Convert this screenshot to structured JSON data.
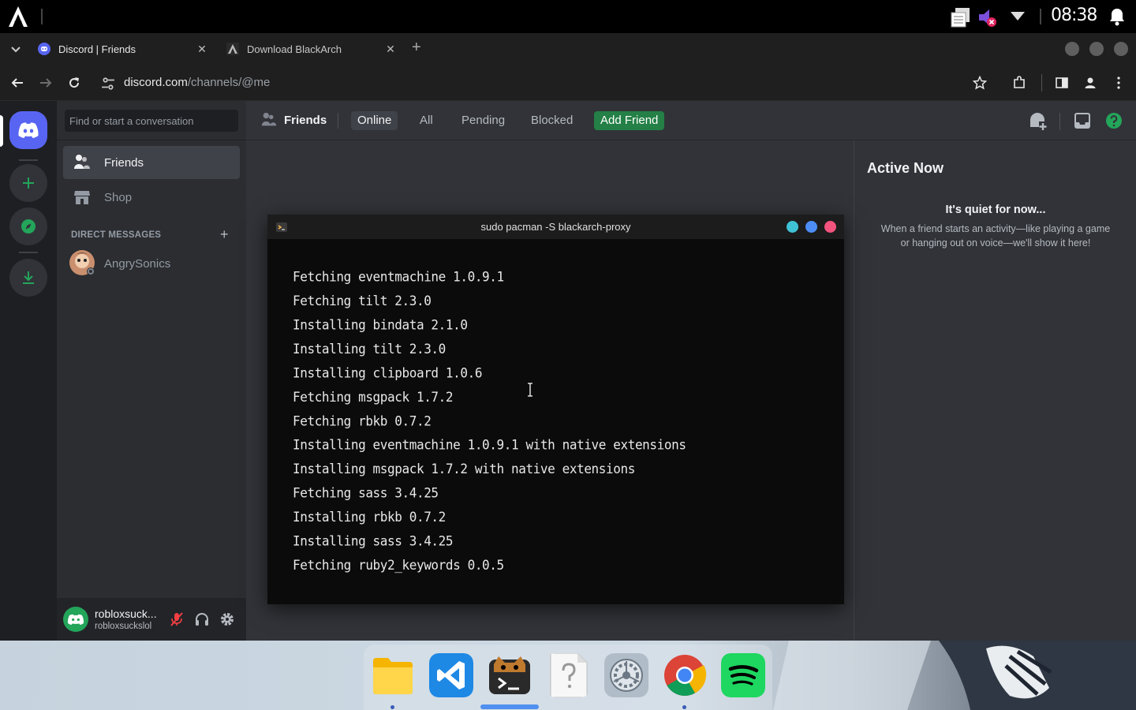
{
  "system": {
    "clock": "08:38"
  },
  "browser": {
    "tabs": [
      {
        "title": "Discord | Friends",
        "close": "✕"
      },
      {
        "title": "Download BlackArch",
        "close": "✕"
      }
    ],
    "new_tab": "+",
    "url_host": "discord.com",
    "url_path": "/channels/@me"
  },
  "discord": {
    "search_placeholder": "Find or start a conversation",
    "nav": {
      "friends": "Friends",
      "shop": "Shop"
    },
    "direct_messages_header": "DIRECT MESSAGES",
    "dm_add": "+",
    "dms": [
      {
        "name": "AngrySonics"
      }
    ],
    "user": {
      "display_name": "robloxsuck...",
      "username": "robloxsuckslol"
    },
    "header": {
      "title": "Friends",
      "tabs": [
        "Online",
        "All",
        "Pending",
        "Blocked"
      ],
      "selected_tab": "Online",
      "add_friend": "Add Friend"
    },
    "active_now": {
      "title": "Active Now",
      "quiet_title": "It's quiet for now...",
      "quiet_body": "When a friend starts an activity—like playing a game or hanging out on voice—we'll show it here!"
    }
  },
  "terminal": {
    "title": "sudo pacman -S blackarch-proxy",
    "lines": [
      "Fetching eventmachine 1.0.9.1",
      "Fetching tilt 2.3.0",
      "Installing bindata 2.1.0",
      "Installing tilt 2.3.0",
      "Installing clipboard 1.0.6",
      "Fetching msgpack 1.7.2",
      "Fetching rbkb 0.7.2",
      "Installing eventmachine 1.0.9.1 with native extensions",
      "Installing msgpack 1.7.2 with native extensions",
      "Fetching sass 3.4.25",
      "Installing rbkb 0.7.2",
      "Installing sass 3.4.25",
      "Fetching ruby2_keywords 0.0.5"
    ]
  },
  "dock": {
    "apps": [
      "files-icon",
      "vscode-icon",
      "terminal-icon",
      "unknown-file-icon",
      "settings-icon",
      "chrome-icon",
      "spotify-icon"
    ]
  },
  "colors": {
    "discord_blurple": "#5865f2",
    "discord_green": "#248046",
    "guild_green": "#23a55a"
  }
}
